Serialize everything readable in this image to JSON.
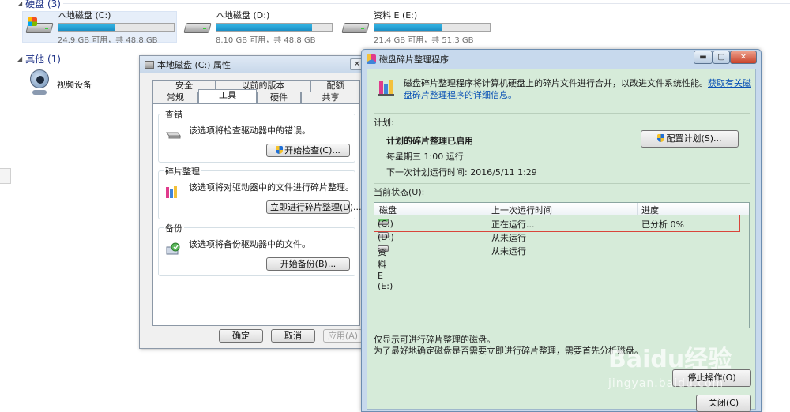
{
  "explorer": {
    "hard_disks_header": "硬盘 (3)",
    "drives": [
      {
        "name": "本地磁盘 (C:)",
        "free": "24.9 GB 可用，共 48.8 GB",
        "used_fraction": 0.49,
        "icon": "windows-drive-icon"
      },
      {
        "name": "本地磁盘 (D:)",
        "free": "8.10 GB 可用，共 48.8 GB",
        "used_fraction": 0.83,
        "icon": "hard-drive-icon"
      },
      {
        "name": "资料 E (E:)",
        "free": "21.4 GB 可用，共 51.3 GB",
        "used_fraction": 0.58,
        "icon": "hard-drive-icon"
      }
    ],
    "other_header": "其他 (1)",
    "other_devices": [
      {
        "name": "视频设备",
        "icon": "webcam-icon"
      }
    ]
  },
  "properties": {
    "title": "本地磁盘 (C:) 属性",
    "tabs_top": [
      "安全",
      "以前的版本",
      "配额"
    ],
    "tabs_bottom": [
      "常规",
      "工具",
      "硬件",
      "共享"
    ],
    "active_tab": "工具",
    "groups": [
      {
        "title": "查错",
        "text": "该选项将检查驱动器中的错误。",
        "button": "开始检查(C)..."
      },
      {
        "title": "碎片整理",
        "text": "该选项将对驱动器中的文件进行碎片整理。",
        "button": "立即进行碎片整理(D)..."
      },
      {
        "title": "备份",
        "text": "该选项将备份驱动器中的文件。",
        "button": "开始备份(B)..."
      }
    ],
    "ok": "确定",
    "cancel": "取消",
    "apply": "应用(A)"
  },
  "defrag": {
    "title": "磁盘碎片整理程序",
    "description": "磁盘碎片整理程序将计算机硬盘上的碎片文件进行合并，以改进文件系统性能。",
    "help_link": "获取有关磁盘碎片整理程序的详细信息。",
    "schedule_label": "计划:",
    "schedule_status": "计划的碎片整理已启用",
    "schedule_time": "每星期三 1:00 运行",
    "next_run": "下一次计划运行时间: 2016/5/11 1:29",
    "configure_button": "配置计划(S)...",
    "current_status_label": "当前状态(U):",
    "columns": [
      "磁盘",
      "上一次运行时间",
      "进度"
    ],
    "rows": [
      {
        "disk": "(C:)",
        "last_run": "正在运行...",
        "progress": "已分析 0%"
      },
      {
        "disk": "(D:)",
        "last_run": "从未运行",
        "progress": ""
      },
      {
        "disk": "资料 E (E:)",
        "last_run": "从未运行",
        "progress": ""
      }
    ],
    "note1": "仅显示可进行碎片整理的磁盘。",
    "note2": "为了最好地确定磁盘是否需要立即进行碎片整理，需要首先分析磁盘。",
    "stop_button": "停止操作(O)",
    "close_button": "关闭(C)"
  },
  "watermark": {
    "brand": "Baidu经验",
    "site": "jingyan.baidu.com"
  }
}
